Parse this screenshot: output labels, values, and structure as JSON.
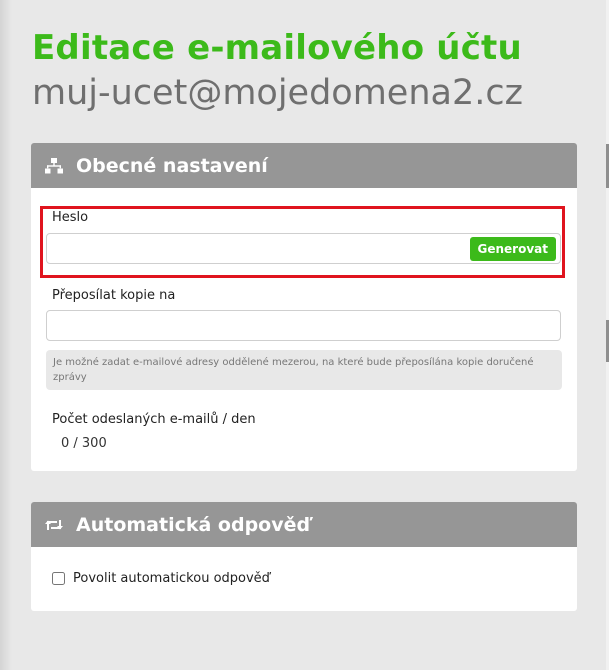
{
  "header": {
    "title": "Editace e-mailového účtu",
    "account": "muj-ucet@mojedomena2.cz"
  },
  "general_panel": {
    "title": "Obecné nastavení",
    "icon": "sitemap-icon",
    "password": {
      "label": "Heslo",
      "value": "",
      "generate_label": "Generovat"
    },
    "forward": {
      "label": "Přeposílat kopie na",
      "value": "",
      "hint": "Je možné zadat e-mailové adresy oddělené mezerou, na které bude přeposílána kopie doručené zprávy"
    },
    "sent_count": {
      "label": "Počet odeslaných e-mailů / den",
      "value": "0 / 300"
    }
  },
  "autoreply_panel": {
    "title": "Automatická odpověď",
    "icon": "retweet-icon",
    "enable_label": "Povolit automatickou odpověď",
    "enabled": false
  },
  "colors": {
    "accent": "#3cba1a",
    "panel_header": "#969696",
    "highlight": "#e0141e",
    "background": "#e8e8e8"
  }
}
